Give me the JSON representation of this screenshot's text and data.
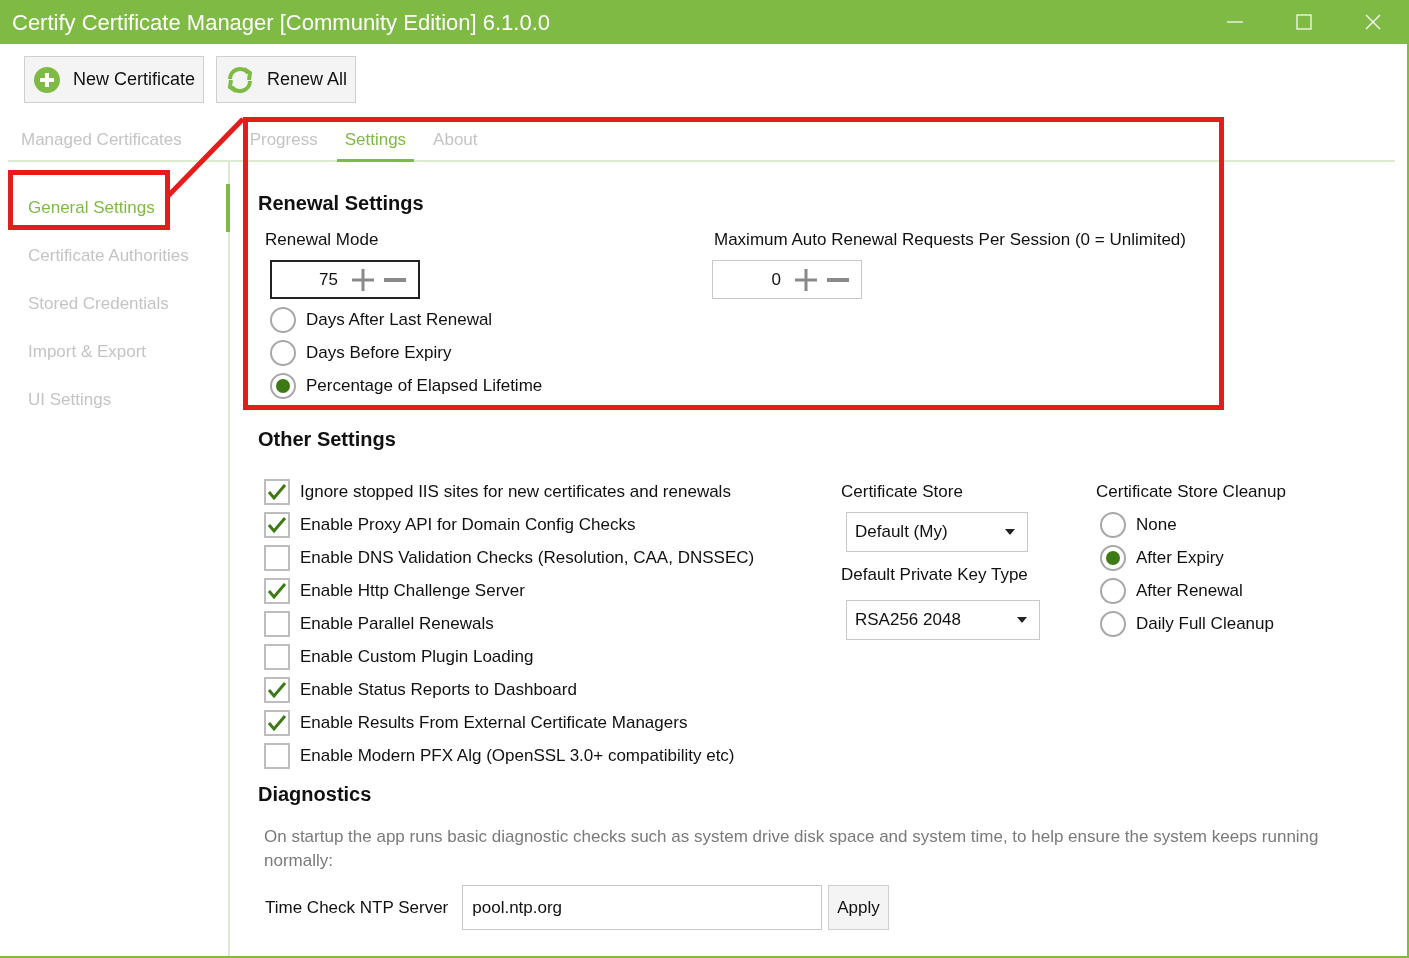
{
  "window": {
    "title": "Certify Certificate Manager [Community Edition] 6.1.0.0"
  },
  "toolbar": [
    {
      "label": "New Certificate",
      "kind": "add"
    },
    {
      "label": "Renew All",
      "kind": "renew"
    }
  ],
  "tabs": [
    {
      "label": "Managed Certificates",
      "selected": false
    },
    {
      "label": "Progress",
      "selected": false
    },
    {
      "label": "Settings",
      "selected": true
    },
    {
      "label": "About",
      "selected": false
    }
  ],
  "sidebar": {
    "items": [
      {
        "label": "General Settings",
        "selected": true
      },
      {
        "label": "Certificate Authorities",
        "selected": false
      },
      {
        "label": "Stored Credentials",
        "selected": false
      },
      {
        "label": "Import & Export",
        "selected": false
      },
      {
        "label": "UI Settings",
        "selected": false
      }
    ]
  },
  "renewal_settings": {
    "heading": "Renewal Settings",
    "renewal_mode": {
      "label": "Renewal Mode",
      "value": "75",
      "focused": true,
      "options": [
        {
          "label": "Days After Last Renewal",
          "selected": false
        },
        {
          "label": "Days Before Expiry",
          "selected": false
        },
        {
          "label": "Percentage of Elapsed Lifetime",
          "selected": true
        }
      ]
    },
    "max_requests": {
      "label": "Maximum Auto Renewal Requests Per Session (0 = Unlimited)",
      "value": "0",
      "focused": false
    }
  },
  "other_settings": {
    "heading": "Other Settings",
    "checkboxes": [
      {
        "label": "Ignore stopped IIS sites for new certificates and renewals",
        "checked": true
      },
      {
        "label": "Enable Proxy API for Domain Config Checks",
        "checked": true
      },
      {
        "label": "Enable DNS Validation Checks (Resolution, CAA, DNSSEC)",
        "checked": false
      },
      {
        "label": "Enable Http Challenge Server",
        "checked": true
      },
      {
        "label": "Enable Parallel Renewals",
        "checked": false
      },
      {
        "label": "Enable Custom Plugin Loading",
        "checked": false
      },
      {
        "label": "Enable Status Reports to Dashboard",
        "checked": true
      },
      {
        "label": "Enable Results From External Certificate Managers",
        "checked": true
      },
      {
        "label": "Enable Modern PFX Alg (OpenSSL 3.0+ compatibility etc)",
        "checked": false
      }
    ],
    "certificate_store": {
      "label": "Certificate Store",
      "value": "Default (My)"
    },
    "private_key_type": {
      "label": "Default Private Key Type",
      "value": "RSA256 2048"
    },
    "store_cleanup": {
      "label": "Certificate Store Cleanup",
      "options": [
        {
          "label": "None",
          "selected": false
        },
        {
          "label": "After Expiry",
          "selected": true
        },
        {
          "label": "After Renewal",
          "selected": false
        },
        {
          "label": "Daily Full Cleanup",
          "selected": false
        }
      ]
    }
  },
  "diagnostics": {
    "heading": "Diagnostics",
    "description": "On startup the app runs basic diagnostic checks such as system drive disk space and system time, to help ensure the system keeps running normally:",
    "ntp_server": {
      "label": "Time Check NTP Server",
      "value": "pool.ntp.org"
    },
    "apply_button": "Apply"
  }
}
